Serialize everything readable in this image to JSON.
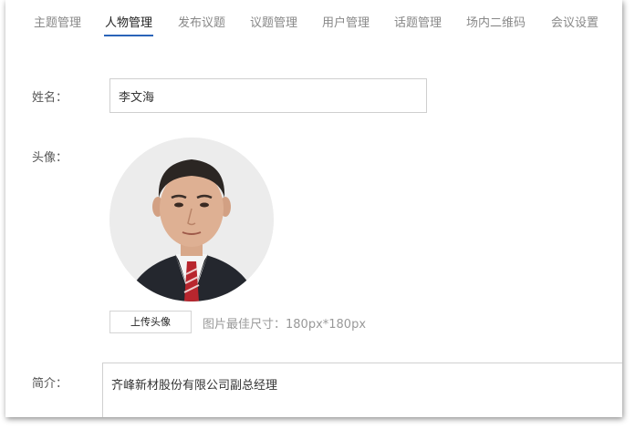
{
  "tabs": [
    {
      "label": "主题管理",
      "active": false
    },
    {
      "label": "人物管理",
      "active": true
    },
    {
      "label": "发布议题",
      "active": false
    },
    {
      "label": "议题管理",
      "active": false
    },
    {
      "label": "用户管理",
      "active": false
    },
    {
      "label": "话题管理",
      "active": false
    },
    {
      "label": "场内二维码",
      "active": false
    },
    {
      "label": "会议设置",
      "active": false
    }
  ],
  "form": {
    "name_label": "姓名：",
    "name_value": "李文海",
    "avatar_label": "头像：",
    "upload_button": "上传头像",
    "size_hint": "图片最佳尺寸：180px*180px",
    "intro_label": "简介：",
    "intro_value": "齐峰新材股份有限公司副总经理"
  },
  "colors": {
    "active_underline": "#2a64b8",
    "tab_inactive": "#888888",
    "hint_text": "#999999"
  }
}
